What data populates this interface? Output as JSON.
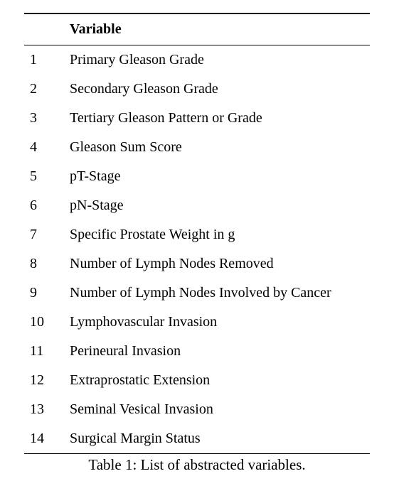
{
  "table": {
    "header": {
      "num": "",
      "variable": "Variable"
    },
    "rows": [
      {
        "num": "1",
        "variable": "Primary Gleason Grade"
      },
      {
        "num": "2",
        "variable": "Secondary Gleason Grade"
      },
      {
        "num": "3",
        "variable": "Tertiary Gleason Pattern or Grade"
      },
      {
        "num": "4",
        "variable": "Gleason Sum Score"
      },
      {
        "num": "5",
        "variable": "pT-Stage"
      },
      {
        "num": "6",
        "variable": "pN-Stage"
      },
      {
        "num": "7",
        "variable": "Specific Prostate Weight in g"
      },
      {
        "num": "8",
        "variable": "Number of Lymph Nodes Removed"
      },
      {
        "num": "9",
        "variable": "Number of Lymph Nodes Involved by Cancer"
      },
      {
        "num": "10",
        "variable": "Lymphovascular Invasion"
      },
      {
        "num": "11",
        "variable": "Perineural Invasion"
      },
      {
        "num": "12",
        "variable": "Extraprostatic Extension"
      },
      {
        "num": "13",
        "variable": "Seminal Vesical Invasion"
      },
      {
        "num": "14",
        "variable": "Surgical Margin Status"
      }
    ]
  },
  "caption": "Table 1: List of abstracted variables."
}
